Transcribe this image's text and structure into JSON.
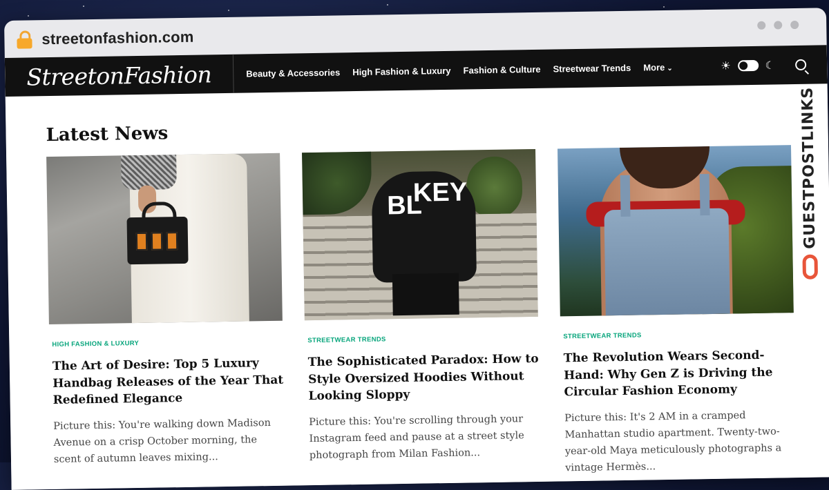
{
  "browser": {
    "url": "streetonfashion.com"
  },
  "site": {
    "logo": "StreetonFashion",
    "nav": [
      {
        "label": "Beauty & Accessories"
      },
      {
        "label": "High Fashion & Luxury"
      },
      {
        "label": "Fashion & Culture"
      },
      {
        "label": "Streetwear Trends"
      },
      {
        "label": "More"
      }
    ],
    "icons": {
      "theme_light": "sun-icon",
      "theme_toggle": "toggle-switch",
      "theme_dark": "moon-icon",
      "search": "search-icon"
    }
  },
  "section": {
    "title": "Latest News"
  },
  "articles": [
    {
      "category": "HIGH FASHION & LUXURY",
      "title": "The Art of Desire: Top 5 Luxury Handbag Releases of the Year That Redefined Elegance",
      "excerpt": "Picture this: You're walking down Madison Avenue on a crisp October morning, the scent of autumn leaves mixing..."
    },
    {
      "category": "STREETWEAR TRENDS",
      "title": "The Sophisticated Paradox: How to Style Oversized Hoodies Without Looking Sloppy",
      "excerpt": "Picture this: You're scrolling through your Instagram feed and pause at a street style photograph from Milan Fashion..."
    },
    {
      "category": "STREETWEAR TRENDS",
      "title": "The Revolution Wears Second-Hand: Why Gen Z is Driving the Circular Fashion Economy",
      "excerpt": "Picture this: It's 2 AM in a cramped Manhattan studio apartment. Twenty-two-year-old Maya meticulously photographs a vintage Hermès..."
    }
  ],
  "watermark": {
    "text": "GUESTPOSTLINKS"
  },
  "colors": {
    "nav_bg": "#111111",
    "category": "#0aa67d",
    "lock": "#f7a82b",
    "watermark_accent": "#e8553a"
  }
}
